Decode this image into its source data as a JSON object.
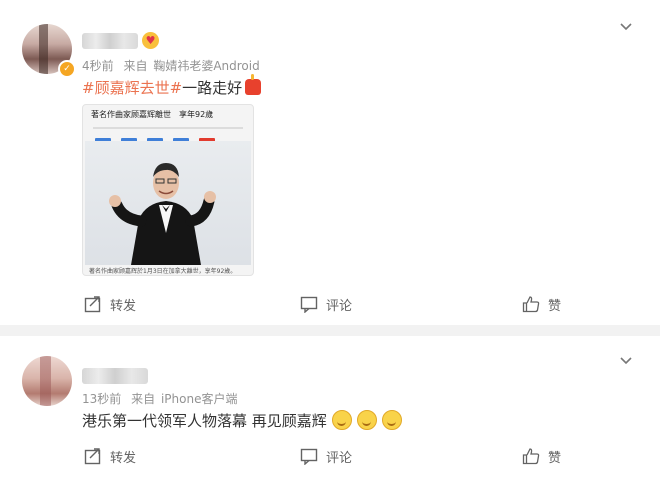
{
  "posts": [
    {
      "time": "4秒前",
      "source_prefix": "来自",
      "source": "鞠婧祎老婆Android",
      "text_tag": "#顾嘉辉去世#",
      "text_body": "一路走好",
      "image": {
        "headline": "著名作曲家顾嘉辉離世　享年92歲",
        "caption": "著名作曲家顾嘉辉於1月3日在加拿大離世，享年92歲。"
      },
      "actions": {
        "repost": "转发",
        "comment": "评论",
        "like": "赞"
      }
    },
    {
      "time": "13秒前",
      "source_prefix": "来自",
      "source": "iPhone客户端",
      "text_body": "港乐第一代领军人物落幕 再见顾嘉辉",
      "actions": {
        "repost": "转发",
        "comment": "评论",
        "like": "赞"
      }
    }
  ],
  "icons": [
    "chevron-down-icon",
    "repost-icon",
    "comment-icon",
    "like-icon",
    "smile-emoji-icon",
    "cake-emoji-icon",
    "heart-eyes-emoji-icon",
    "verified-badge-icon"
  ],
  "colors": {
    "accent": "#eb7350",
    "meta": "#939393",
    "text": "#333333",
    "background": "#f2f2f2",
    "badge": "#f5a623"
  }
}
